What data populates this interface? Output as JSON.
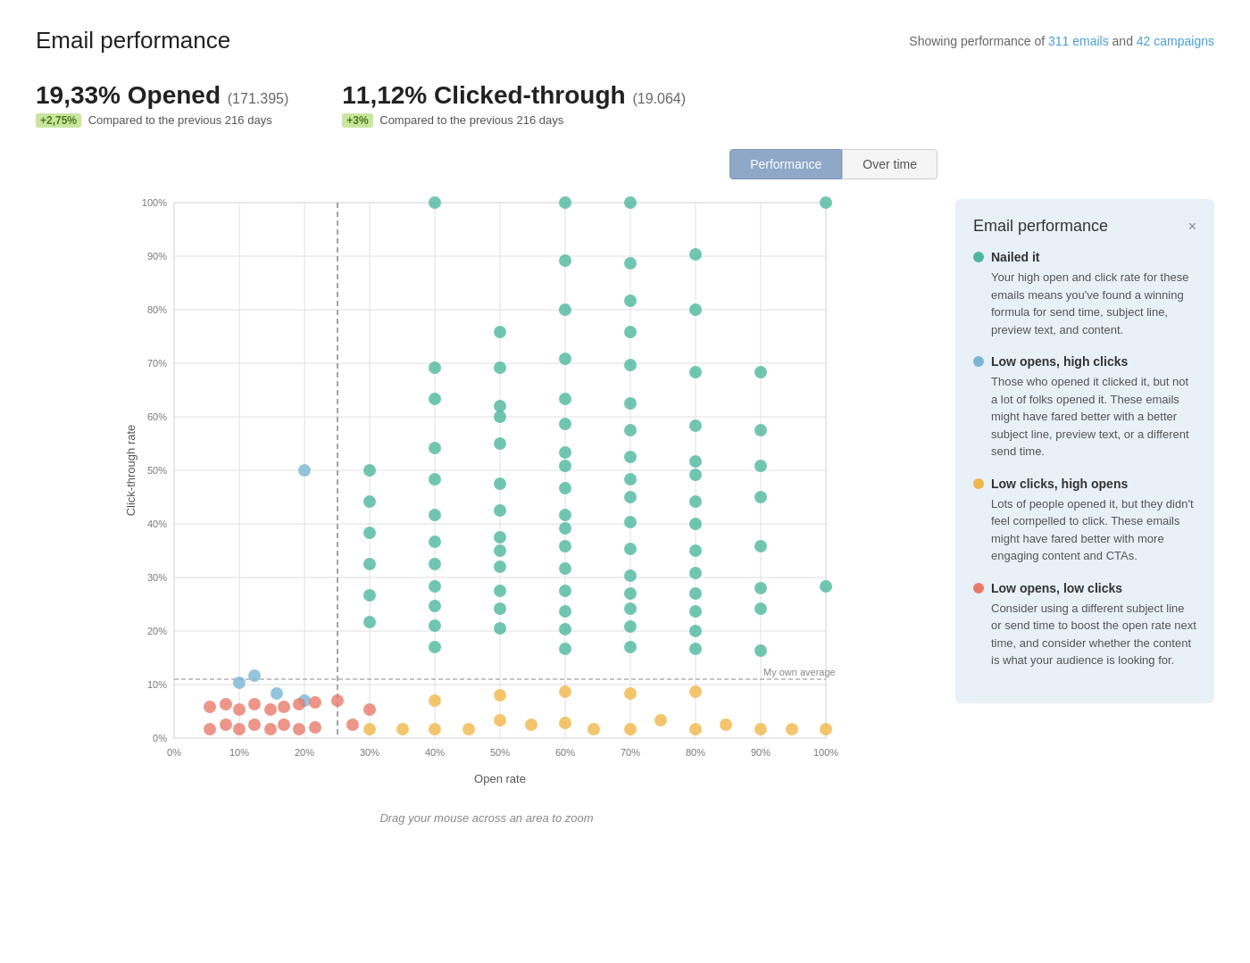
{
  "page": {
    "title": "Email performance",
    "header_meta_prefix": "Showing performance of ",
    "emails_link": "311 emails",
    "campaigns_link": "42 campaigns",
    "header_meta_mid": " and "
  },
  "stats": {
    "opened_pct": "19,33% Opened",
    "opened_count": "(171.395)",
    "opened_badge": "+2,75%",
    "opened_compare": "Compared to the previous 216 days",
    "clicked_pct": "11,12% Clicked-through",
    "clicked_count": "(19.064)",
    "clicked_badge": "+3%",
    "clicked_compare": "Compared to the previous 216 days"
  },
  "tabs": {
    "performance_label": "Performance",
    "over_time_label": "Over time"
  },
  "chart": {
    "y_axis_label": "Click-through rate",
    "x_axis_label": "Open rate",
    "avg_label": "My own average",
    "drag_hint": "Drag your mouse across an area to zoom",
    "y_ticks": [
      "100%",
      "90%",
      "80%",
      "70%",
      "60%",
      "50%",
      "40%",
      "30%",
      "20%",
      "10%",
      "0%"
    ],
    "x_ticks": [
      "0%",
      "10%",
      "20%",
      "30%",
      "40%",
      "50%",
      "60%",
      "70%",
      "80%",
      "90%",
      "100%"
    ]
  },
  "info_card": {
    "title": "Email performance",
    "close_label": "×",
    "items": [
      {
        "color": "#4db89e",
        "label": "Nailed it",
        "desc": "Your high open and click rate for these emails means you've found a winning formula for send time, subject line, preview text, and content."
      },
      {
        "color": "#7ab5d4",
        "label": "Low opens, high clicks",
        "desc": "Those who opened it clicked it, but not a lot of folks opened it. These emails might have fared better with a better subject line, preview text, or a different send time."
      },
      {
        "color": "#f0b84a",
        "label": "Low clicks, high opens",
        "desc": "Lots of people opened it, but they didn't feel compelled to click. These emails might have fared better with more engaging content and CTAs."
      },
      {
        "color": "#e87a6a",
        "label": "Low opens, low clicks",
        "desc": "Consider using a different subject line or send time to boost the open rate next time, and consider whether the content is what your audience is looking for."
      }
    ]
  },
  "colors": {
    "teal": "#4db89e",
    "blue": "#7ab5d4",
    "orange": "#f0b84a",
    "red": "#e87a6a",
    "tab_active": "#8fa8c8"
  }
}
